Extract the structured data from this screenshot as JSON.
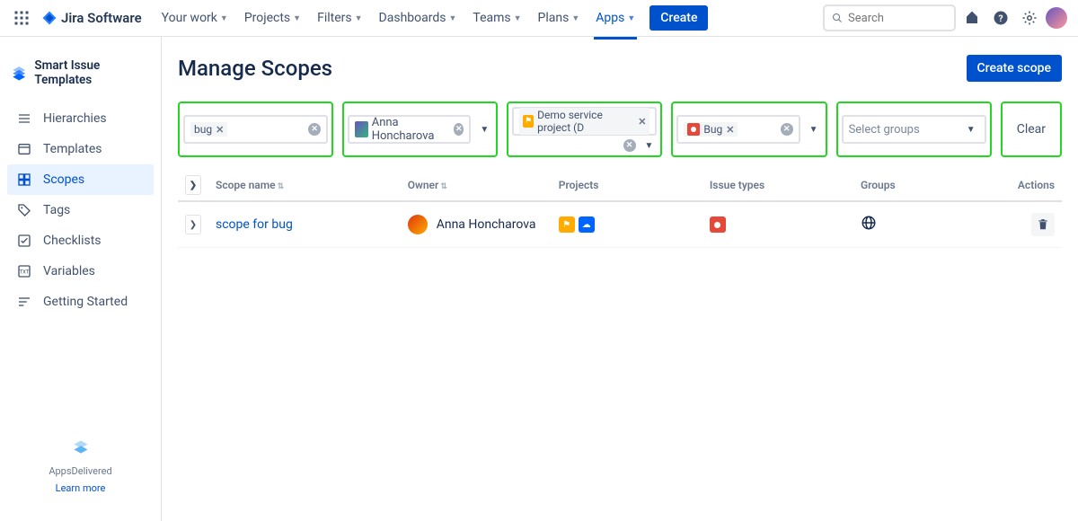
{
  "topnav": {
    "logo_text": "Jira Software",
    "items": [
      {
        "label": "Your work"
      },
      {
        "label": "Projects"
      },
      {
        "label": "Filters"
      },
      {
        "label": "Dashboards"
      },
      {
        "label": "Teams"
      },
      {
        "label": "Plans"
      },
      {
        "label": "Apps"
      }
    ],
    "create_label": "Create",
    "search_placeholder": "Search"
  },
  "sidebar": {
    "brand": "Smart Issue Templates",
    "items": [
      {
        "label": "Hierarchies"
      },
      {
        "label": "Templates"
      },
      {
        "label": "Scopes"
      },
      {
        "label": "Tags"
      },
      {
        "label": "Checklists"
      },
      {
        "label": "Variables"
      },
      {
        "label": "Getting Started"
      }
    ],
    "footer_text": "AppsDelivered",
    "footer_link": "Learn more"
  },
  "page": {
    "title": "Manage Scopes",
    "create_btn": "Create scope"
  },
  "filters": {
    "search_chip": "bug",
    "owner": "Anna Honcharova",
    "project_chip": "Demo service project (D",
    "issue_type_chip": "Bug",
    "groups_placeholder": "Select groups",
    "clear_label": "Clear"
  },
  "table": {
    "headers": {
      "name": "Scope name",
      "owner": "Owner",
      "projects": "Projects",
      "types": "Issue types",
      "groups": "Groups",
      "actions": "Actions"
    },
    "rows": [
      {
        "name": "scope for bug",
        "owner": "Anna Honcharova"
      }
    ]
  }
}
